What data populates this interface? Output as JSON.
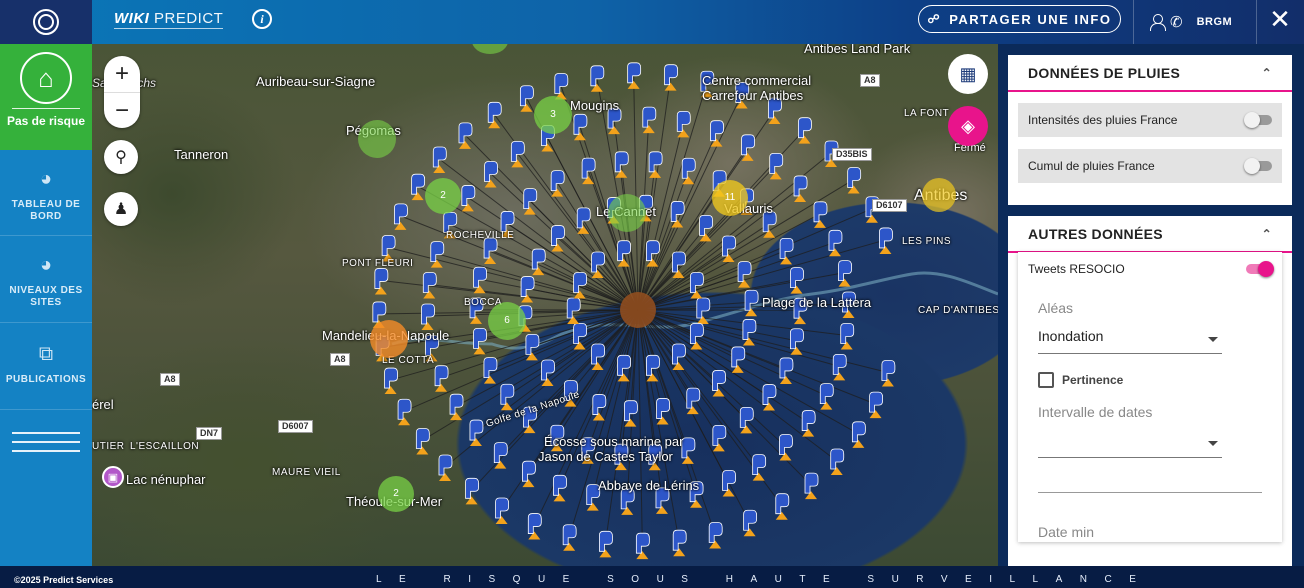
{
  "header": {
    "brand_bold": "WIKI",
    "brand_light": "PREDICT",
    "share_label": "PARTAGER UNE INFO",
    "user_name": "BRGM"
  },
  "sidebar": {
    "home_label": "Pas de risque",
    "items": [
      {
        "label": "TABLEAU DE BORD",
        "icon": "gauge-icon"
      },
      {
        "label": "NIVEAUX DES SITES",
        "icon": "gauge-icon"
      },
      {
        "label": "PUBLICATIONS",
        "icon": "documents-icon"
      }
    ]
  },
  "map": {
    "places": [
      {
        "name": "Sax adrechs",
        "text": "Saï adrechs"
      },
      {
        "name": "auribeau",
        "text": "Auribeau-sur-Siagne"
      },
      {
        "name": "pegomas",
        "text": "Pégomas"
      },
      {
        "name": "tanneron",
        "text": "Tanneron"
      },
      {
        "name": "mougins",
        "text": "Mougins"
      },
      {
        "name": "centre-commercial",
        "text": "Centre commercial"
      },
      {
        "name": "carrefour",
        "text": "Carrefour Antibes"
      },
      {
        "name": "antibes-land-park",
        "text": "Antibes Land Park"
      },
      {
        "name": "la-fontonne",
        "text": "LA FONT"
      },
      {
        "name": "ferme",
        "text": "Fermé"
      },
      {
        "name": "le-cannet",
        "text": "Le Cannet"
      },
      {
        "name": "vallauris",
        "text": "Vallauris"
      },
      {
        "name": "antibes",
        "text": "Antibes"
      },
      {
        "name": "rocheville",
        "text": "ROCHEVILLE"
      },
      {
        "name": "pont-fleuri",
        "text": "PONT FLEURI"
      },
      {
        "name": "la-bocca",
        "text": "BOCCA"
      },
      {
        "name": "les-pins",
        "text": "LES PINS"
      },
      {
        "name": "plage-lassatera",
        "text": "Plage de la Lattera"
      },
      {
        "name": "cap-antibes",
        "text": "CAP D'ANTIBES"
      },
      {
        "name": "mandelieu",
        "text": "Mandelieu-la-Napoule"
      },
      {
        "name": "le-cotta",
        "text": "LE COTTA"
      },
      {
        "name": "golfe",
        "text": "Golfe de la Napoule"
      },
      {
        "name": "ecosse",
        "text": "Écosse sous marine par"
      },
      {
        "name": "jason",
        "text": "Jason de Castes Taylor"
      },
      {
        "name": "abbaye",
        "text": "Abbaye de Lérins"
      },
      {
        "name": "esterel",
        "text": "érel"
      },
      {
        "name": "tier",
        "text": "UTIER"
      },
      {
        "name": "escaillon",
        "text": "L'ESCAILLON"
      },
      {
        "name": "maure-vieil",
        "text": "MAURE VIEIL"
      },
      {
        "name": "lac-nenuphar",
        "text": "Lac nénuphar"
      },
      {
        "name": "theoule",
        "text": "Théoule-sur-Mer"
      }
    ],
    "roads": [
      "A8",
      "A8",
      "A8",
      "D35BIS",
      "D6107",
      "DN7",
      "D6007"
    ],
    "clusters": [
      "3",
      "2",
      "11",
      "6",
      "2"
    ]
  },
  "panel": {
    "rain": {
      "title": "DONNÉES DE PLUIES",
      "toggles": [
        {
          "label": "Intensités des pluies France",
          "on": false
        },
        {
          "label": "Cumul de pluies France",
          "on": false
        }
      ]
    },
    "other": {
      "title": "AUTRES DONNÉES",
      "tweets_label": "Tweets RESOCIO",
      "tweets_on": true,
      "aleas_label": "Aléas",
      "aleas_value": "Inondation",
      "pertinence_label": "Pertinence",
      "dates_label": "Intervalle de dates",
      "dates_value": "",
      "date_min_label": "Date min"
    }
  },
  "footer": {
    "copyright": "©2025 Predict Services",
    "slogan": "LE RISQUE SOUS HAUTE SURVEILLANCE"
  },
  "colors": {
    "accent_pink": "#e8148b",
    "home_green": "#35b13b",
    "sidebar_blue": "#1482c4",
    "marker_blue": "#2d56c9",
    "marker_orange": "#f3a21b"
  }
}
